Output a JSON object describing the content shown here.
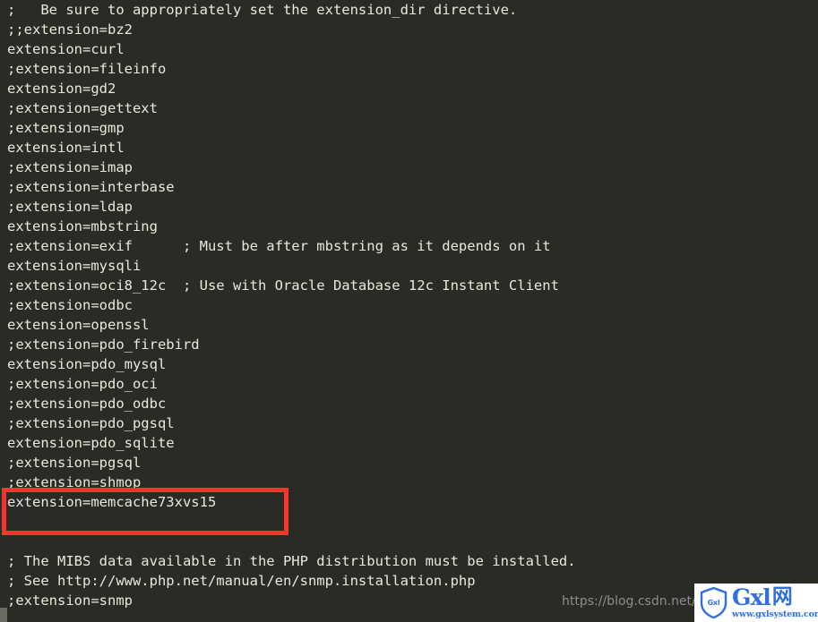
{
  "window": {
    "background_color": "#2b2b26",
    "text_color": "#e8e8e0",
    "file_kind": "php.ini configuration file"
  },
  "code": {
    "language": "ini",
    "lines": [
      ";   Be sure to appropriately set the extension_dir directive.",
      ";;extension=bz2",
      "extension=curl",
      ";extension=fileinfo",
      "extension=gd2",
      ";extension=gettext",
      ";extension=gmp",
      "extension=intl",
      ";extension=imap",
      ";extension=interbase",
      ";extension=ldap",
      "extension=mbstring",
      ";extension=exif      ; Must be after mbstring as it depends on it",
      "extension=mysqli",
      ";extension=oci8_12c  ; Use with Oracle Database 12c Instant Client",
      ";extension=odbc",
      "extension=openssl",
      ";extension=pdo_firebird",
      "extension=pdo_mysql",
      ";extension=pdo_oci",
      ";extension=pdo_odbc",
      ";extension=pdo_pgsql",
      "extension=pdo_sqlite",
      ";extension=pgsql",
      ";extension=shmop",
      "extension=memcache73xvs15",
      "",
      "",
      "; The MIBS data available in the PHP distribution must be installed.",
      "; See http://www.php.net/manual/en/snmp.installation.php",
      ";extension=snmp"
    ]
  },
  "annotation": {
    "type": "rectangle",
    "color": "#fa332c",
    "stroke_width": 5,
    "highlighted_text": "extension=memcache73xvs15"
  },
  "watermark": {
    "url_text": "https://blog.csdn.net/"
  },
  "logo": {
    "shield_label": "Gxl",
    "wordmark": "Gxl",
    "wordmark_cn": "网",
    "domain": "www.gxlsystem.com",
    "brand_color": "#2f6fe0"
  }
}
